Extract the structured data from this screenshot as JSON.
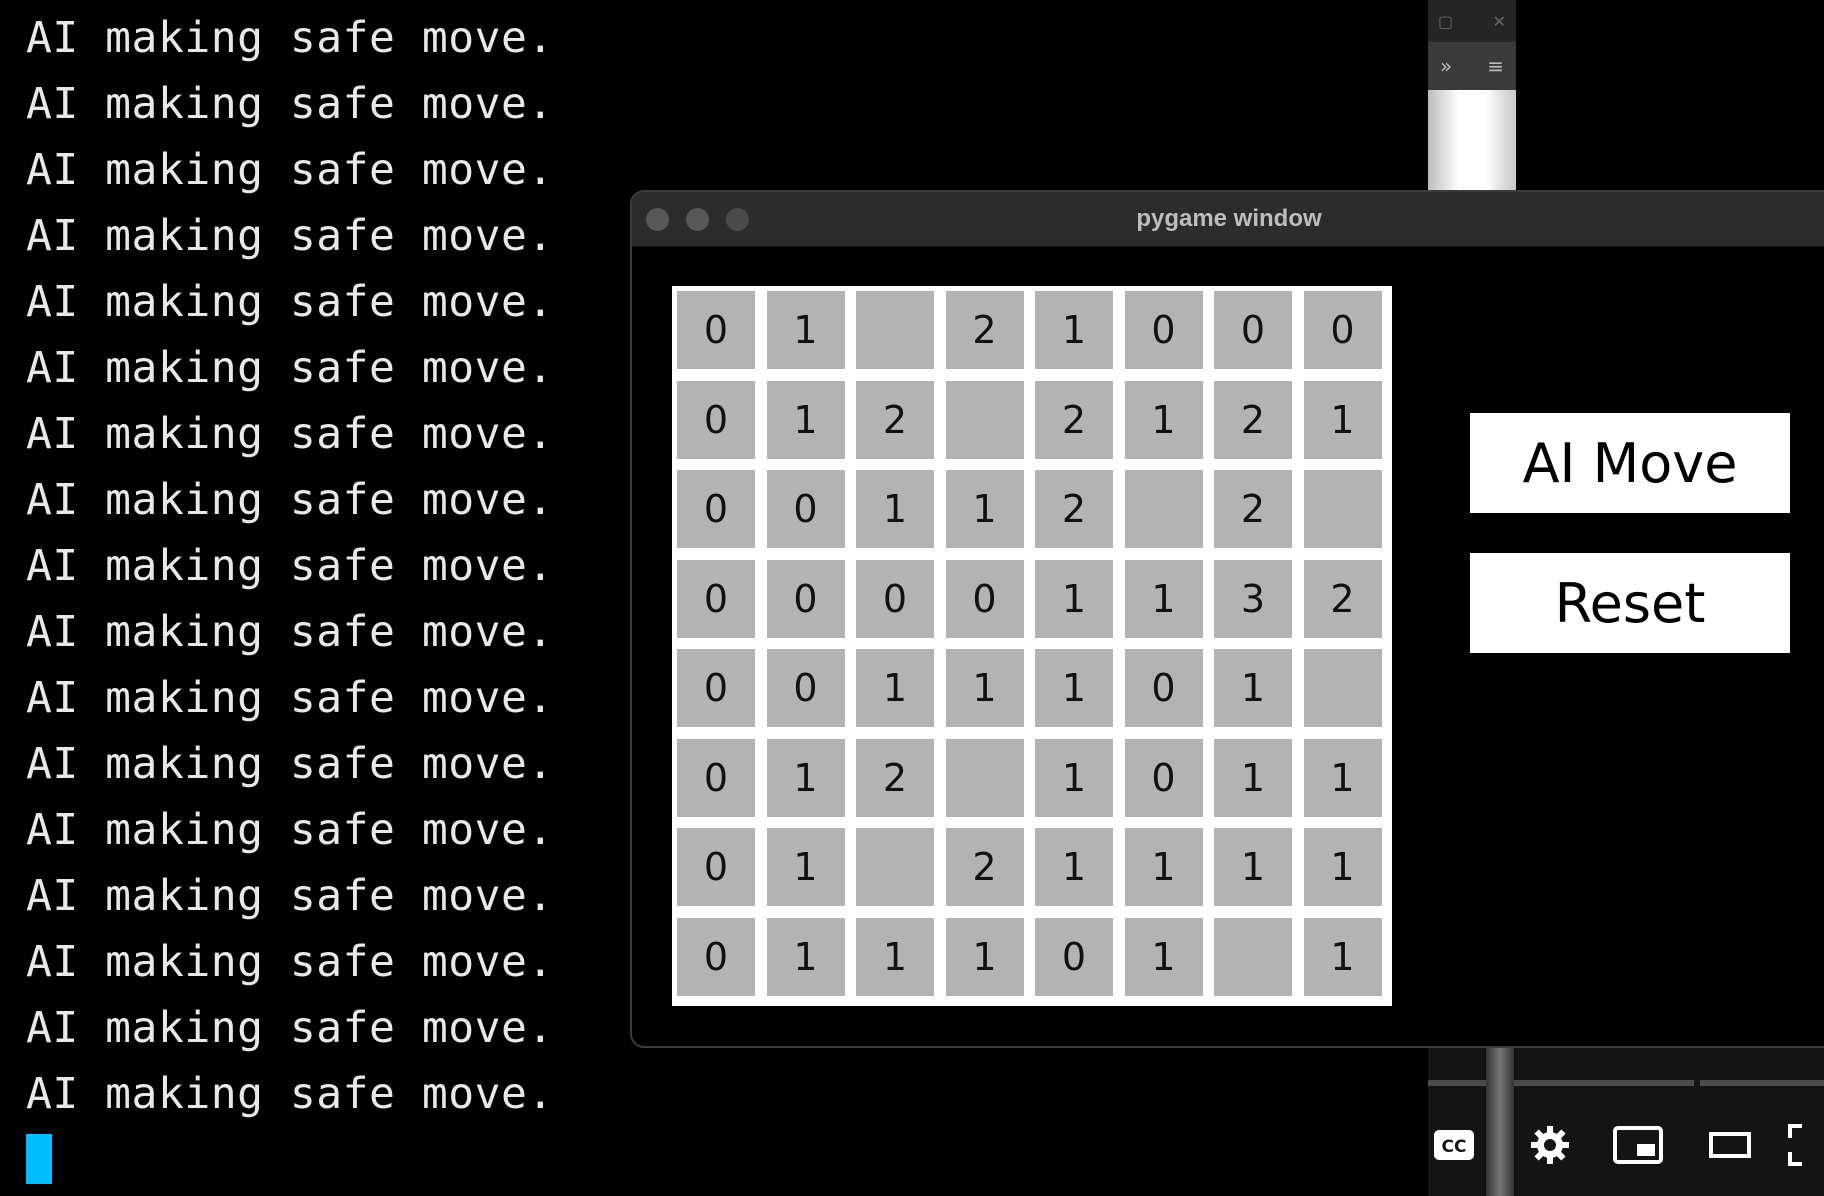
{
  "terminal": {
    "lines": [
      "AI making safe move.",
      "AI making safe move.",
      "AI making safe move.",
      "AI making safe move.",
      "AI making safe move.",
      "AI making safe move.",
      "AI making safe move.",
      "AI making safe move.",
      "AI making safe move.",
      "AI making safe move.",
      "AI making safe move.",
      "AI making safe move.",
      "AI making safe move.",
      "AI making safe move.",
      "AI making safe move.",
      "AI making safe move.",
      "AI making safe move."
    ],
    "cursor_color": "#00bfff"
  },
  "pygame_window": {
    "title": "pygame window",
    "board": [
      [
        "0",
        "1",
        "",
        "2",
        "1",
        "0",
        "0",
        "0"
      ],
      [
        "0",
        "1",
        "2",
        "",
        "2",
        "1",
        "2",
        "1"
      ],
      [
        "0",
        "0",
        "1",
        "1",
        "2",
        "",
        "2",
        ""
      ],
      [
        "0",
        "0",
        "0",
        "0",
        "1",
        "1",
        "3",
        "2"
      ],
      [
        "0",
        "0",
        "1",
        "1",
        "1",
        "0",
        "1",
        ""
      ],
      [
        "0",
        "1",
        "2",
        "",
        "1",
        "0",
        "1",
        "1"
      ],
      [
        "0",
        "1",
        "",
        "2",
        "1",
        "1",
        "1",
        "1"
      ],
      [
        "0",
        "1",
        "1",
        "1",
        "0",
        "1",
        "",
        "1"
      ]
    ],
    "buttons": {
      "ai_move": "AI Move",
      "reset": "Reset"
    },
    "colors": {
      "cell": "#b3b3b3",
      "grid": "#ffffff",
      "background": "#000000"
    }
  },
  "video_controls": {
    "icons": [
      "closed-captions-icon",
      "settings-gear-icon",
      "miniplayer-icon",
      "theater-mode-icon",
      "fullscreen-icon"
    ],
    "captions_label": "CC"
  }
}
